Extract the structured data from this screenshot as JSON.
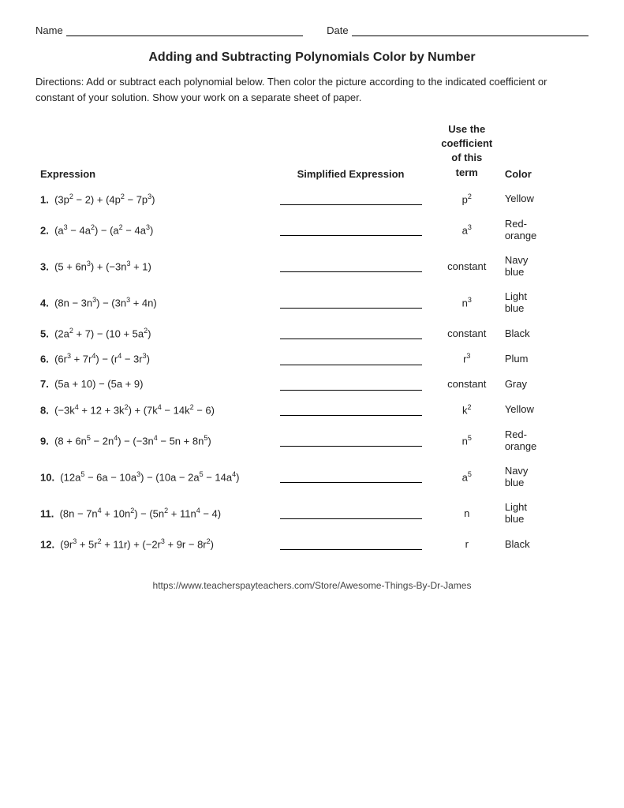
{
  "header": {
    "name_label": "Name",
    "date_label": "Date"
  },
  "title": "Adding and Subtracting Polynomials Color by Number",
  "directions": "Directions: Add or subtract each polynomial below.  Then color the picture according to the indicated coefficient or constant of your solution. Show your work on a separate sheet of paper.",
  "table": {
    "col_headers": {
      "expression": "Expression",
      "simplified": "Simplified Expression",
      "use_coefficient": "Use the\ncoefficient\nof this\nterm",
      "color": "Color"
    },
    "rows": [
      {
        "num": "1.",
        "expression_html": "(3p<sup>2</sup> − 2) + (4p<sup>2</sup> − 7p<sup>3</sup>)",
        "term_html": "p<sup>2</sup>",
        "color": "Yellow"
      },
      {
        "num": "2.",
        "expression_html": "(a<sup>3</sup> − 4a<sup>2</sup>) − (a<sup>2</sup> − 4a<sup>3</sup>)",
        "term_html": "a<sup>3</sup>",
        "color": "Red-\norange"
      },
      {
        "num": "3.",
        "expression_html": "(5 + 6n<sup>3</sup>) + (−3n<sup>3</sup> + 1)",
        "term_html": "constant",
        "color": "Navy\nblue"
      },
      {
        "num": "4.",
        "expression_html": "(8n − 3n<sup>3</sup>) − (3n<sup>3</sup> + 4n)",
        "term_html": "n<sup>3</sup>",
        "color": "Light\nblue"
      },
      {
        "num": "5.",
        "expression_html": "(2a<sup>2</sup> + 7) − (10 + 5a<sup>2</sup>)",
        "term_html": "constant",
        "color": "Black"
      },
      {
        "num": "6.",
        "expression_html": "(6r<sup>3</sup> + 7r<sup>4</sup>) − (r<sup>4</sup> − 3r<sup>3</sup>)",
        "term_html": "r<sup>3</sup>",
        "color": "Plum"
      },
      {
        "num": "7.",
        "expression_html": "(5a + 10) − (5a + 9)",
        "term_html": "constant",
        "color": "Gray"
      },
      {
        "num": "8.",
        "expression_html": "(−3k<sup>4</sup> + 12 + 3k<sup>2</sup>) + (7k<sup>4</sup> − 14k<sup>2</sup> − 6)",
        "term_html": "k<sup>2</sup>",
        "color": "Yellow"
      },
      {
        "num": "9.",
        "expression_html": "(8 + 6n<sup>5</sup> − 2n<sup>4</sup>) − (−3n<sup>4</sup> − 5n + 8n<sup>5</sup>)",
        "term_html": "n<sup>5</sup>",
        "color": "Red-\norange"
      },
      {
        "num": "10.",
        "expression_html": "(12a<sup>5</sup> − 6a − 10a<sup>3</sup>) − (10a − 2a<sup>5</sup> − 14a<sup>4</sup>)",
        "term_html": "a<sup>5</sup>",
        "color": "Navy\nblue"
      },
      {
        "num": "11.",
        "expression_html": "(8n − 7n<sup>4</sup> + 10n<sup>2</sup>) − (5n<sup>2</sup> + 11n<sup>4</sup> − 4)",
        "term_html": "n",
        "color": "Light\nblue"
      },
      {
        "num": "12.",
        "expression_html": "(9r<sup>3</sup> + 5r<sup>2</sup> + 11r) + (−2r<sup>3</sup> + 9r − 8r<sup>2</sup>)",
        "term_html": "r",
        "color": "Black"
      }
    ]
  },
  "footer": "https://www.teacherspayteachers.com/Store/Awesome-Things-By-Dr-James"
}
